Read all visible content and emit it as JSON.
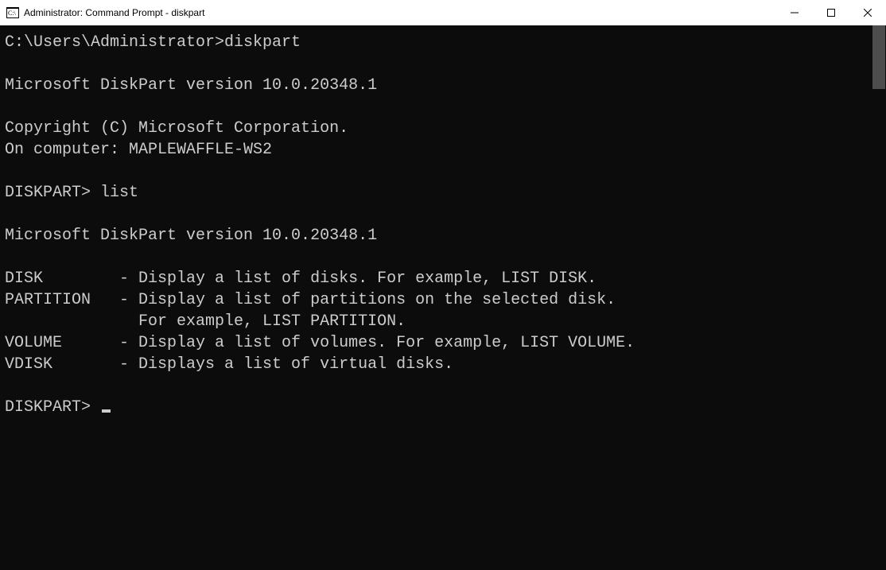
{
  "titlebar": {
    "title": "Administrator: Command Prompt - diskpart"
  },
  "console": {
    "prompt1_path": "C:\\Users\\Administrator>",
    "prompt1_cmd": "diskpart",
    "version_line_1": "Microsoft DiskPart version 10.0.20348.1",
    "copyright": "Copyright (C) Microsoft Corporation.",
    "on_computer": "On computer: MAPLEWAFFLE-WS2",
    "diskpart_prompt": "DISKPART> ",
    "cmd_list": "list",
    "version_line_2": "Microsoft DiskPart version 10.0.20348.1",
    "help_disk": "DISK        - Display a list of disks. For example, LIST DISK.",
    "help_partition": "PARTITION   - Display a list of partitions on the selected disk.",
    "help_partition2": "              For example, LIST PARTITION.",
    "help_volume": "VOLUME      - Display a list of volumes. For example, LIST VOLUME.",
    "help_vdisk": "VDISK       - Displays a list of virtual disks."
  }
}
